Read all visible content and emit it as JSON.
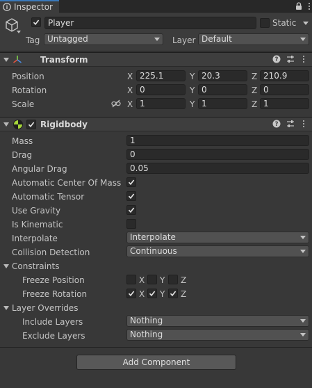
{
  "window": {
    "tab_title": "Inspector",
    "tab_icon": "info-icon"
  },
  "gameobject": {
    "active": true,
    "name": "Player",
    "static_label": "Static",
    "static_checked": false,
    "tag_label": "Tag",
    "tag_value": "Untagged",
    "layer_label": "Layer",
    "layer_value": "Default"
  },
  "transform": {
    "title": "Transform",
    "icon": "transform-axes-icon",
    "position_label": "Position",
    "rotation_label": "Rotation",
    "scale_label": "Scale",
    "axis_x": "X",
    "axis_y": "Y",
    "axis_z": "Z",
    "position": {
      "x": "225.1",
      "y": "20.3",
      "z": "210.9"
    },
    "rotation": {
      "x": "0",
      "y": "0",
      "z": "0"
    },
    "scale": {
      "x": "1",
      "y": "1",
      "z": "1"
    }
  },
  "rigidbody": {
    "title": "Rigidbody",
    "icon": "rigidbody-sphere-icon",
    "enabled": true,
    "mass_label": "Mass",
    "mass": "1",
    "drag_label": "Drag",
    "drag": "0",
    "angular_drag_label": "Angular Drag",
    "angular_drag": "0.05",
    "auto_com_label": "Automatic Center Of Mass",
    "auto_com": true,
    "auto_tensor_label": "Automatic Tensor",
    "auto_tensor": true,
    "use_gravity_label": "Use Gravity",
    "use_gravity": true,
    "is_kinematic_label": "Is Kinematic",
    "is_kinematic": false,
    "interpolate_label": "Interpolate",
    "interpolate": "Interpolate",
    "collision_label": "Collision Detection",
    "collision": "Continuous",
    "constraints_label": "Constraints",
    "freeze_position_label": "Freeze Position",
    "freeze_position": {
      "x": false,
      "y": false,
      "z": false
    },
    "freeze_rotation_label": "Freeze Rotation",
    "freeze_rotation": {
      "x": true,
      "y": true,
      "z": true
    },
    "layer_overrides_label": "Layer Overrides",
    "include_layers_label": "Include Layers",
    "include_layers": "Nothing",
    "exclude_layers_label": "Exclude Layers",
    "exclude_layers": "Nothing"
  },
  "add_component_label": "Add Component",
  "colors": {
    "panel": "#383838",
    "header": "#3e3e3e",
    "field": "#2a2a2a",
    "dropdown": "#515151",
    "tab_accent": "#3a79bb"
  }
}
